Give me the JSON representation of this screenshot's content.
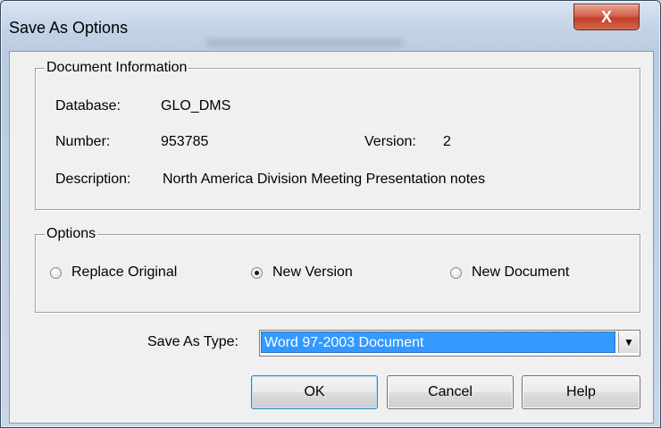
{
  "window": {
    "title": "Save As Options",
    "close_glyph": "X"
  },
  "document_info": {
    "legend": "Document Information",
    "database_label": "Database:",
    "database_value": "GLO_DMS",
    "number_label": "Number:",
    "number_value": "953785",
    "version_label": "Version:",
    "version_value": "2",
    "description_label": "Description:",
    "description_value": "North America Division Meeting Presentation notes"
  },
  "options": {
    "legend": "Options",
    "radios": [
      {
        "label": "Replace Original",
        "checked": false
      },
      {
        "label": "New Version",
        "checked": true
      },
      {
        "label": "New Document",
        "checked": false
      }
    ]
  },
  "save_as_type": {
    "label": "Save As Type:",
    "value": "Word 97-2003 Document",
    "arrow_glyph": "▼"
  },
  "buttons": {
    "ok": "OK",
    "cancel": "Cancel",
    "help": "Help"
  },
  "colors": {
    "selection": "#3399ff",
    "close_button": "#c8432c"
  }
}
